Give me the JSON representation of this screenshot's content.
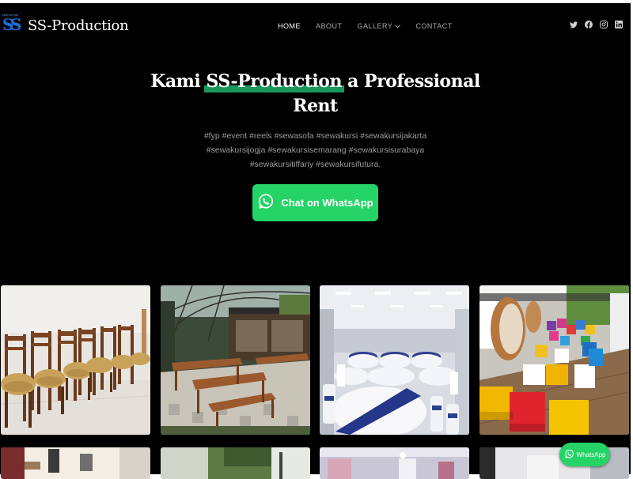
{
  "brand": {
    "name": "SS-Production",
    "logo_mark_tiny": "PRODUCTION",
    "logo_mark_letters": "SS"
  },
  "nav": {
    "items": [
      {
        "label": "HOME",
        "active": true
      },
      {
        "label": "ABOUT",
        "active": false
      },
      {
        "label": "GALLERY",
        "active": false,
        "dropdown": true
      },
      {
        "label": "CONTACT",
        "active": false
      }
    ]
  },
  "social": [
    "twitter-icon",
    "facebook-icon",
    "instagram-icon",
    "linkedin-icon"
  ],
  "hero": {
    "title_before": "Kami ",
    "title_highlight": "SS-Production",
    "title_after": " a Professional",
    "title_line2": "Rent",
    "highlight_color": "#1fb36b",
    "description": "#fyp #event #reels #sewasofa #sewakursi #sewakursijakarta #sewakursijogja #sewakursisemarang #sewakursisurabaya #sewakursitiffany #sewakursifutura.",
    "cta_label": "Chat on WhatsApp"
  },
  "gallery": {
    "tiles": [
      "tile-wooden-chairs",
      "tile-outdoor-benches",
      "tile-banquet-hall",
      "tile-colorful-cubes",
      "tile-row2-1",
      "tile-row2-2",
      "tile-row2-3",
      "tile-row2-4"
    ]
  },
  "floating_whatsapp": {
    "label": "WhatsApp"
  },
  "colors": {
    "background": "#000000",
    "whatsapp_green": "#25d366",
    "nav_inactive": "#a9a9a9",
    "description_text": "#9b9b9b"
  }
}
